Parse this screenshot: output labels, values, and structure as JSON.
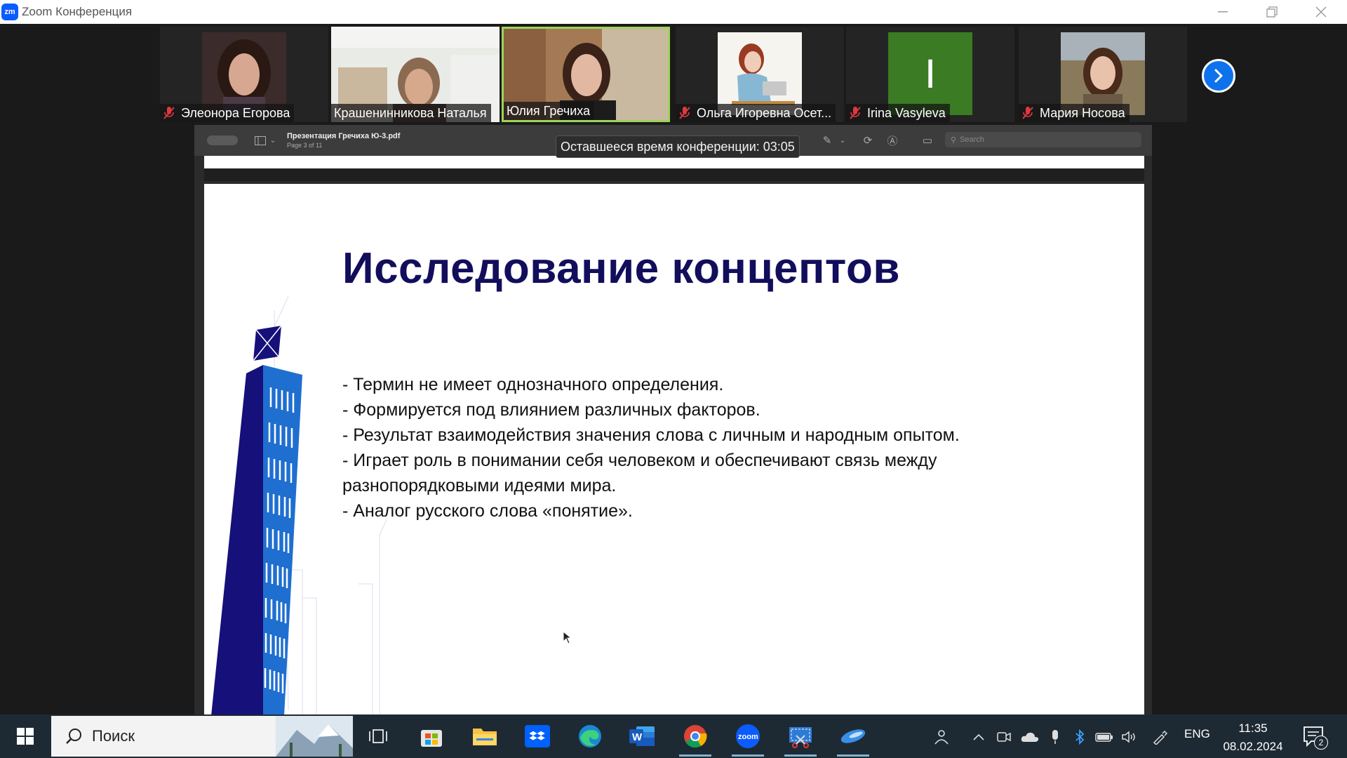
{
  "window": {
    "title": "Zoom Конференция",
    "logo_text": "zm"
  },
  "participants": [
    {
      "name": "Элеонора Егорова",
      "muted": true
    },
    {
      "name": "Крашенинникова Наталья",
      "muted": false
    },
    {
      "name": "Юлия Гречиха",
      "muted": false,
      "active": true
    },
    {
      "name": "Ольга Игоревна Осет...",
      "muted": true
    },
    {
      "name": "Irina Vasyleva",
      "muted": true,
      "initial": "I"
    },
    {
      "name": "Мария Носова",
      "muted": true
    }
  ],
  "remaining_time": "Оставшееся время конференции: 03:05",
  "pdf": {
    "filename": "Презентация Гречиха Ю-3.pdf",
    "page_info": "Page 3 of 11",
    "search_placeholder": "Search"
  },
  "slide": {
    "title": "Исследование концептов",
    "bullets": [
      "- Термин не имеет однозначного определения.",
      "- Формируется под влиянием различных факторов.",
      "- Результат взаимодействия значения слова с личным и народным опытом.",
      "- Играет роль в понимании себя человеком и обеспечивают связь между разнопорядковыми идеями мира.",
      "- Аналог русского слова «понятие»."
    ]
  },
  "taskbar": {
    "search_label": "Поиск",
    "language": "ENG",
    "time": "11:35",
    "date": "08.02.2024",
    "notification_count": "2"
  },
  "colors": {
    "zoom_blue": "#0b5cff",
    "active_speaker": "#9ed35a",
    "slide_title": "#120e5c",
    "building_blue": "#1f6fd0",
    "building_navy": "#15107a"
  }
}
